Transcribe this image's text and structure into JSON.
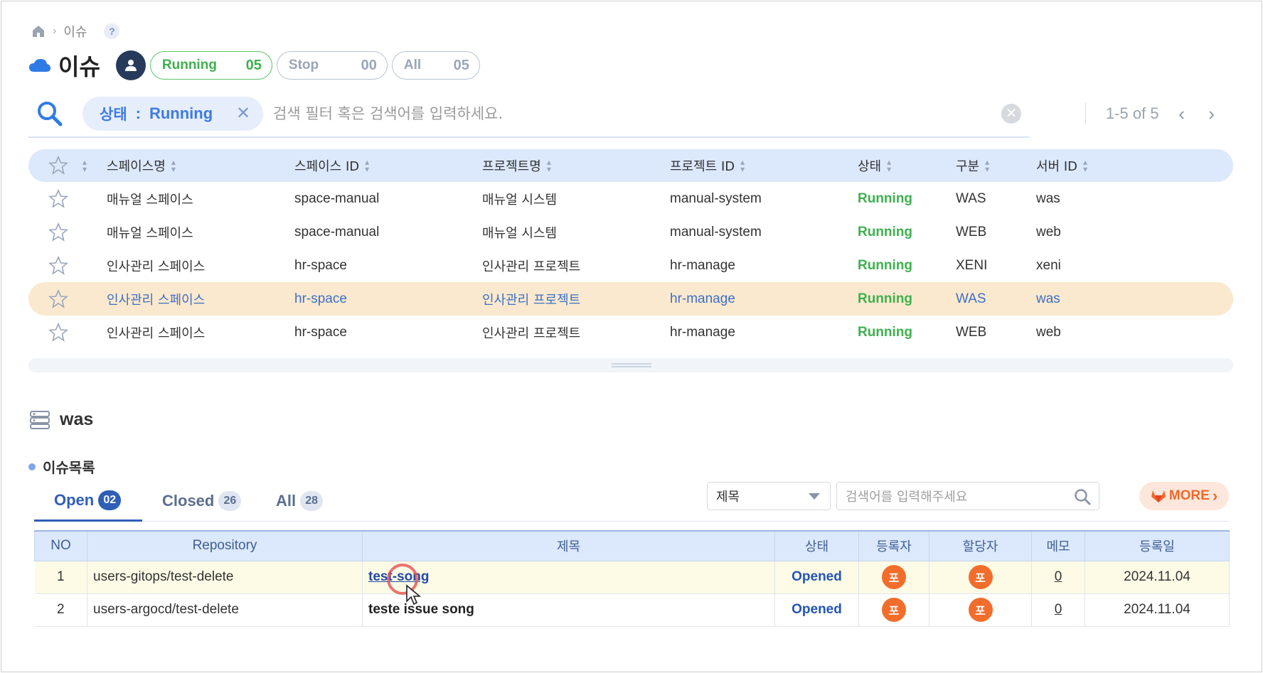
{
  "breadcrumb": {
    "current": "이슈",
    "help": "?"
  },
  "header": {
    "title": "이슈",
    "pills": [
      {
        "label": "Running",
        "count": "05"
      },
      {
        "label": "Stop",
        "count": "00"
      },
      {
        "label": "All",
        "count": "05"
      }
    ]
  },
  "search": {
    "chip_key": "상태",
    "chip_sep": ":",
    "chip_value": "Running",
    "placeholder": "검색 필터 혹은 검색어를 입력하세요.",
    "pager": "1-5 of 5"
  },
  "table": {
    "headers": [
      "스페이스명",
      "스페이스 ID",
      "프로젝트명",
      "프로젝트 ID",
      "상태",
      "구분",
      "서버 ID"
    ],
    "rows": [
      [
        "매뉴얼 스페이스",
        "space-manual",
        "매뉴얼 시스템",
        "manual-system",
        "Running",
        "WAS",
        "was"
      ],
      [
        "매뉴얼 스페이스",
        "space-manual",
        "매뉴얼 시스템",
        "manual-system",
        "Running",
        "WEB",
        "web"
      ],
      [
        "인사관리 스페이스",
        "hr-space",
        "인사관리 프로젝트",
        "hr-manage",
        "Running",
        "XENI",
        "xeni"
      ],
      [
        "인사관리 스페이스",
        "hr-space",
        "인사관리 프로젝트",
        "hr-manage",
        "Running",
        "WAS",
        "was"
      ],
      [
        "인사관리 스페이스",
        "hr-space",
        "인사관리 프로젝트",
        "hr-manage",
        "Running",
        "WEB",
        "web"
      ]
    ],
    "selected_row": 3
  },
  "server": {
    "name": "was"
  },
  "issues": {
    "section_label": "이슈목록",
    "tabs": [
      {
        "label": "Open",
        "count": "02"
      },
      {
        "label": "Closed",
        "count": "26"
      },
      {
        "label": "All",
        "count": "28"
      }
    ],
    "filter_select": "제목",
    "search_placeholder": "검색어를 입력해주세요",
    "more_label": "MORE",
    "headers": [
      "NO",
      "Repository",
      "제목",
      "상태",
      "등록자",
      "할당자",
      "메모",
      "등록일"
    ],
    "rows": [
      {
        "no": "1",
        "repo": "users-gitops/test-delete",
        "title": "test-song",
        "state": "Opened",
        "author": "포",
        "assignee": "포",
        "memo": "0",
        "date": "2024.11.04"
      },
      {
        "no": "2",
        "repo": "users-argocd/test-delete",
        "title": "teste issue song",
        "state": "Opened",
        "author": "포",
        "assignee": "포",
        "memo": "0",
        "date": "2024.11.04"
      }
    ]
  },
  "colors": {
    "accent": "#2f5fb6",
    "running": "#3fb04f",
    "selected_row": "#fae9cf",
    "gitlab": "#f0682a"
  }
}
